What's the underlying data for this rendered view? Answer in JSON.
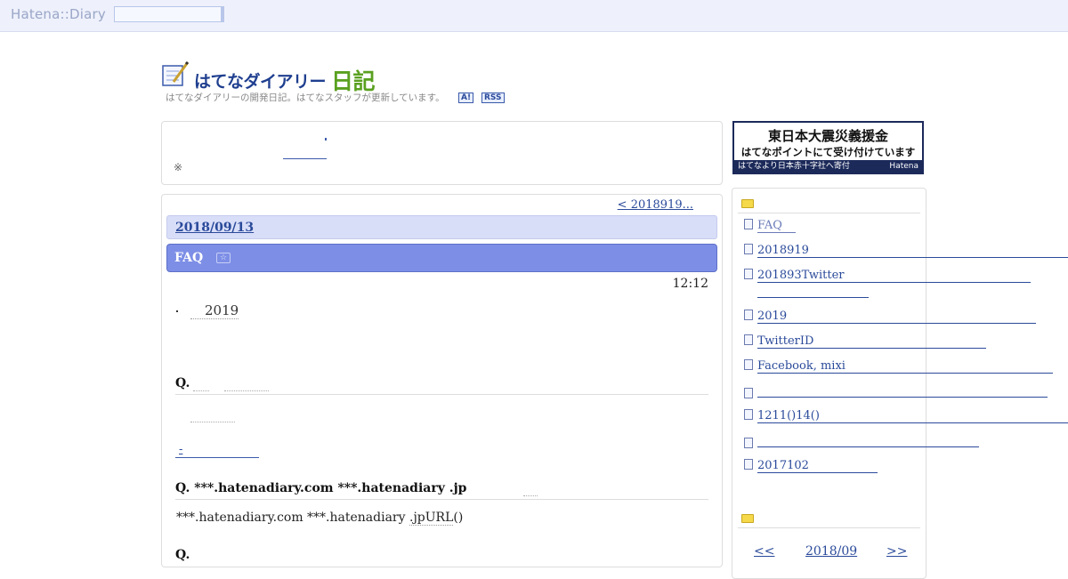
{
  "topbar": {
    "logo": "Hatena::Diary"
  },
  "header": {
    "title": "はてなダイアリー",
    "title_kanji": "日記",
    "description": "はてなダイアリーの開発日記。はてなスタッフが更新しています。",
    "feed_a": "A!",
    "feed_rss": "RSS"
  },
  "notice": {
    "mark": "※"
  },
  "content": {
    "prev_link": "< 2018919...",
    "date": "2018/09/13",
    "entry_title": "FAQ",
    "time": "12:12",
    "intro_text": "2019",
    "q1": "Q.",
    "answer_link": "-",
    "q2": "Q. ***.hatenadiary.com  ***.hatenadiary       .jp",
    "answer2_pre": "***.hatenadiary.com  ***.hatenadiary       ",
    "answer2_link": ".jpURL",
    "answer2_post": "()",
    "q3": "Q."
  },
  "banner": {
    "line1": "東日本大震災義援金",
    "line2": "はてなポイントにて受け付けています",
    "line3": "はてなより日本赤十字社へ寄付",
    "brand": "Hatena"
  },
  "sidebar": {
    "items": [
      {
        "label": "FAQ"
      },
      {
        "label": "2018919"
      },
      {
        "label": "201893Twitter"
      },
      {
        "label": "2019"
      },
      {
        "label": "TwitterID"
      },
      {
        "label": "Facebook, mixi"
      },
      {
        "label": ""
      },
      {
        "label": "1211()14()"
      },
      {
        "label": ""
      },
      {
        "label": "2017102"
      }
    ],
    "calendar": {
      "prev": "<<",
      "month": "2018/09",
      "next": ">>"
    }
  }
}
